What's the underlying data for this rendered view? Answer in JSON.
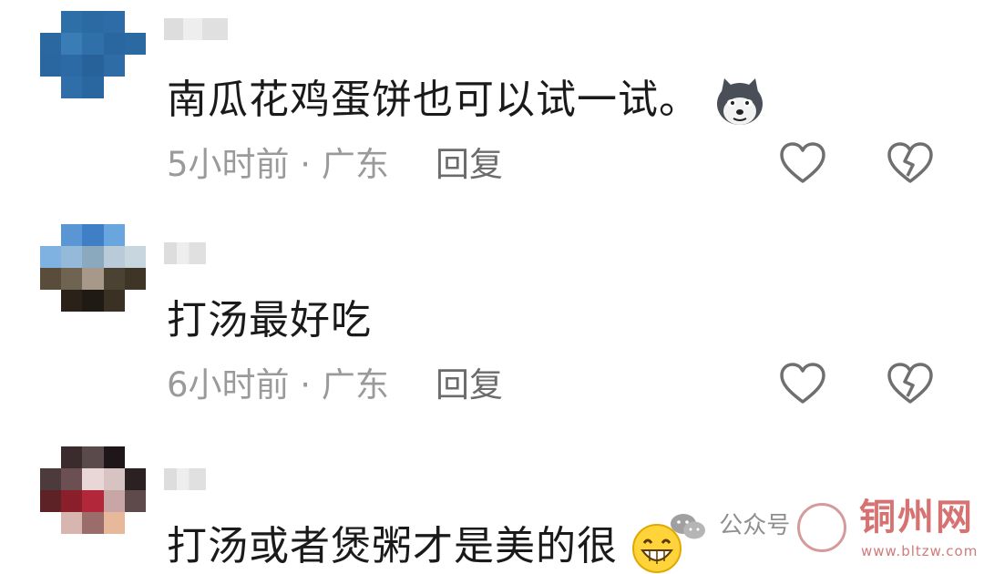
{
  "comments": [
    {
      "text": "南瓜花鸡蛋饼也可以试一试。",
      "time": "5小时前 · 广东",
      "reply_label": "回复",
      "emoji_icon": "husky-dog-emoji-icon"
    },
    {
      "text": "打汤最好吃",
      "time": "6小时前 · 广东",
      "reply_label": "回复"
    },
    {
      "text": "打汤或者煲粥才是美的很",
      "emoji_icon": "grinning-face-emoji-icon"
    }
  ],
  "watermark": {
    "label": "公众号",
    "site_title": "铜州网",
    "site_url": "www.bltzw.com"
  },
  "colors": {
    "text": "#1a1a1a",
    "meta": "#9a9a9a",
    "icon_stroke": "#6f6f6f"
  }
}
